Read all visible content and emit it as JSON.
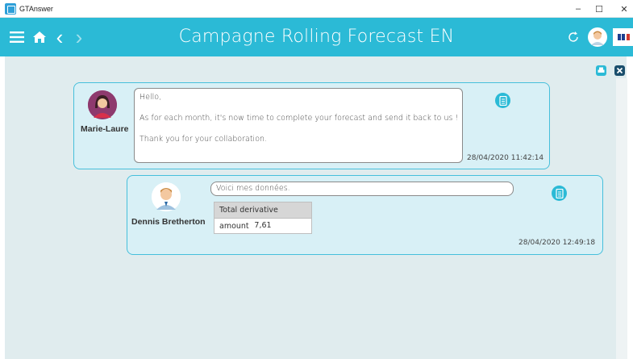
{
  "window": {
    "app_name": "GTAnswer",
    "minimize_glyph": "–",
    "maximize_glyph": "☐",
    "close_glyph": "✕"
  },
  "header": {
    "title": "Campagne Rolling Forecast EN",
    "back_glyph": "‹",
    "forward_glyph": "›",
    "flag_text": "I"
  },
  "colors": {
    "header": "#2bbad6",
    "card_border": "#46bfdb",
    "card_fill": "#d8f0f6",
    "content_bg": "#e0ecee"
  },
  "messages": [
    {
      "author": "Marie-Laure",
      "lines": [
        "Hello,",
        "As for each month, it's now time to complete your forecast and send it back to us !",
        "Thank you for your collaboration."
      ],
      "timestamp": "28/04/2020 11:42:14"
    },
    {
      "author": "Dennis Bretherton",
      "text": "Voici mes données.",
      "table": {
        "header": "Total derivative amount",
        "value": "7,61"
      },
      "timestamp": "28/04/2020 12:49:18"
    }
  ],
  "icons": {
    "menu": "hamburger-icon",
    "home": "home-icon",
    "back": "chevron-left-icon",
    "forward": "chevron-right-icon",
    "refresh": "refresh-icon",
    "avatar": "user-avatar",
    "flag": "flag-icon",
    "document": "document-icon"
  }
}
